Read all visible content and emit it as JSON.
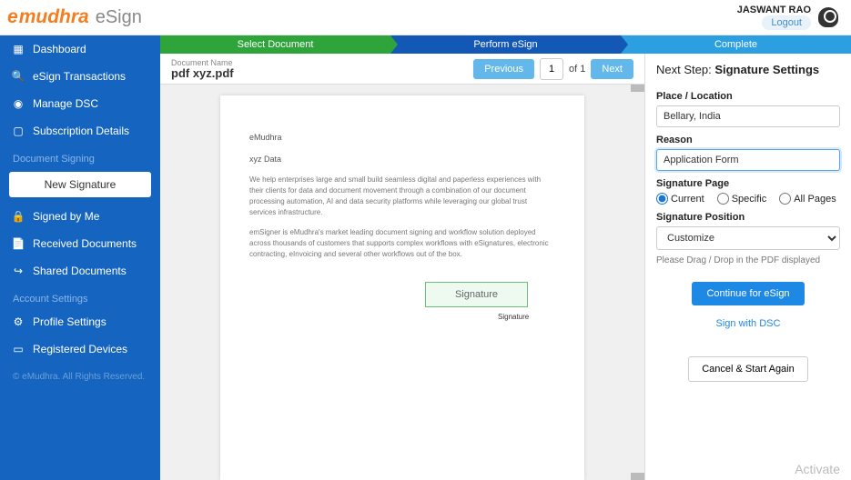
{
  "header": {
    "logo_prefix": "e",
    "logo_main": "mudhra",
    "logo_suffix": "eSign",
    "user_name": "JASWANT RAO",
    "logout": "Logout"
  },
  "sidebar": {
    "items": [
      {
        "label": "Dashboard",
        "icon": "▦"
      },
      {
        "label": "eSign Transactions",
        "icon": "🔍"
      },
      {
        "label": "Manage DSC",
        "icon": "◉"
      },
      {
        "label": "Subscription Details",
        "icon": "▢"
      }
    ],
    "section_signing": "Document Signing",
    "new_signature": "New Signature",
    "signing_items": [
      {
        "label": "Signed by Me",
        "icon": "🔒"
      },
      {
        "label": "Received Documents",
        "icon": "📄"
      },
      {
        "label": "Shared Documents",
        "icon": "↪"
      }
    ],
    "section_account": "Account Settings",
    "account_items": [
      {
        "label": "Profile Settings",
        "icon": "⚙"
      },
      {
        "label": "Registered Devices",
        "icon": "▭"
      }
    ],
    "copyright": "© eMudhra. All Rights Reserved."
  },
  "steps": {
    "s1": "Select Document",
    "s2": "Perform eSign",
    "s3": "Complete"
  },
  "doc": {
    "name_label": "Document Name",
    "name": "pdf xyz.pdf",
    "prev": "Previous",
    "page": "1",
    "of": "of 1",
    "next": "Next",
    "pdf_brand": "eMudhra",
    "pdf_sub": "xyz Data",
    "pdf_p1": "We help enterprises large and small build seamless digital and paperless experiences with their clients for data and document movement through a combination of our document processing automation, AI and data security platforms while leveraging our global trust services infrastructure.",
    "pdf_p2": "emSigner is eMudhra's market leading document signing and workflow solution deployed across thousands of customers that supports complex workflows with eSignatures, electronic contracting, eInvoicing and several other workflows out of the box.",
    "sig_box": "Signature",
    "sig_label": "Signature"
  },
  "right": {
    "next_step_prefix": "Next Step: ",
    "next_step_bold": "Signature Settings",
    "place_label": "Place / Location",
    "place_value": "Bellary, India",
    "reason_label": "Reason",
    "reason_value": "Application Form",
    "sig_page_label": "Signature Page",
    "radio_current": "Current",
    "radio_specific": "Specific",
    "radio_all": "All Pages",
    "sig_pos_label": "Signature Position",
    "sig_pos_value": "Customize",
    "hint": "Please Drag / Drop in the PDF displayed",
    "continue": "Continue for eSign",
    "sign_dsc": "Sign with DSC",
    "cancel": "Cancel & Start Again"
  },
  "watermark": "Activate"
}
